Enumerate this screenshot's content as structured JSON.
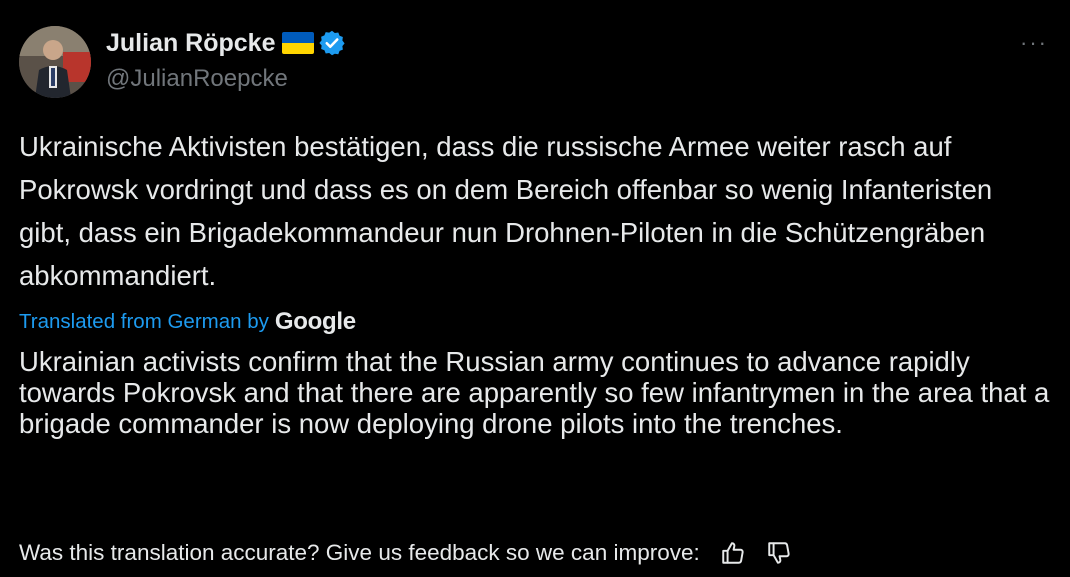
{
  "author": {
    "display_name": "Julian Röpcke",
    "handle": "@JulianRoepcke",
    "flag": "ukraine-flag",
    "verified_badge": "verified-icon",
    "colors": {
      "verified": "#1d9bf0",
      "flag_blue": "#005bbb",
      "flag_yellow": "#ffd500"
    }
  },
  "menu": {
    "icon": "more-icon",
    "label": "···"
  },
  "post": {
    "original_text": "Ukrainische Aktivisten bestätigen, dass die russische Armee weiter rasch auf Pokrowsk vordringt und dass es on dem Bereich offenbar so wenig Infanteristen gibt, dass ein Brigadekommandeur nun Drohnen-Piloten in die Schützengräben abkommandiert."
  },
  "translation": {
    "label": "Translated from German by",
    "provider": "Google",
    "text": "Ukrainian activists confirm that the Russian army continues to advance rapidly towards Pokrovsk and that there are apparently so few infantrymen in the area that a brigade commander is now deploying drone pilots into the trenches.",
    "label_color": "#1d9bf0"
  },
  "feedback": {
    "prompt": "Was this translation accurate? Give us feedback so we can improve:",
    "thumbs_up_icon": "thumbs-up-icon",
    "thumbs_down_icon": "thumbs-down-icon"
  },
  "theme": {
    "background": "#000000",
    "text": "#e7e9ea",
    "muted": "#71767b"
  }
}
